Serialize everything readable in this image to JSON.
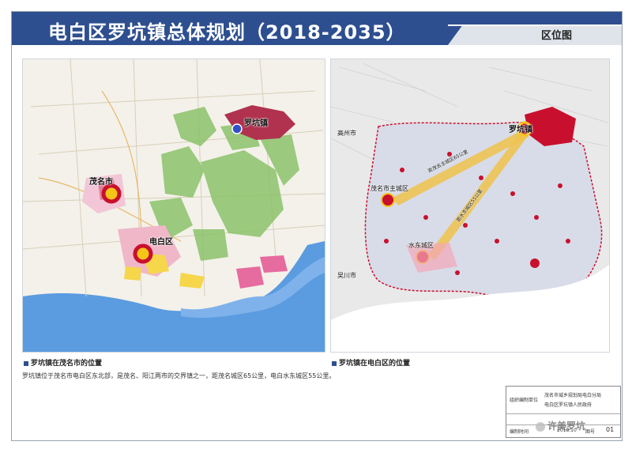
{
  "header": {
    "title": "电白区罗坑镇总体规划（2018-2035）",
    "tab": "区位图"
  },
  "left_map": {
    "caption": "罗坑镇在茂名市的位置",
    "labels": [
      "罗坑镇",
      "茂名市",
      "电白区"
    ]
  },
  "right_map": {
    "caption": "罗坑镇在电白区的位置",
    "labels": [
      "罗坑镇",
      "茂名市主城区",
      "水东城区",
      "高州市",
      "吴川市"
    ],
    "corridors": [
      "距茂名主城区65公里",
      "距水东城区55公里"
    ]
  },
  "description": "罗坑镇位于茂名市电白区东北部，是茂名、阳江两市的交界镇之一，距茂名城区65公里，电白水东城区55公里。",
  "title_block": {
    "org_label": "组织编制单位",
    "org_value": "茂名市城乡规划局电白分局",
    "org_value2": "电白区罗坑镇人民政府",
    "date_label": "编制时间",
    "date_value": "2018.10",
    "sheet_label": "图号",
    "sheet_value": "01"
  },
  "watermark": "许美罗坑",
  "colors": {
    "header": "#2e4f8f",
    "sea": "#4a90d9",
    "highlight": "#c8102e"
  }
}
